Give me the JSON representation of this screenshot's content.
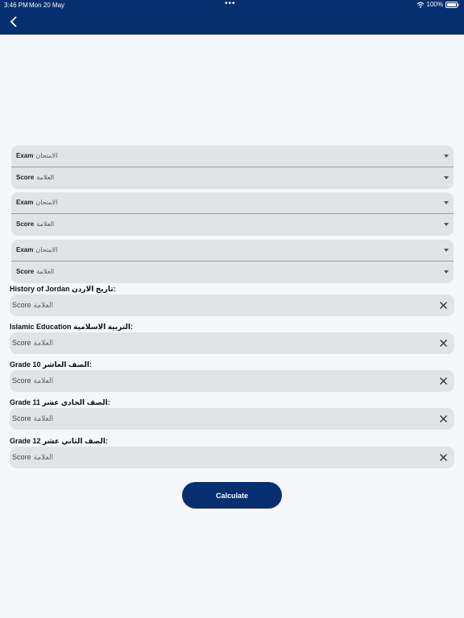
{
  "status_bar": {
    "time": "3:46 PM",
    "date": "Mon 20 May",
    "battery": "100%"
  },
  "exam_groups": [
    {
      "exam_en": "Exam",
      "exam_ar": "الامتحان",
      "score_en": "Score",
      "score_ar": "العلامة"
    },
    {
      "exam_en": "Exam",
      "exam_ar": "الامتحان",
      "score_en": "Score",
      "score_ar": "العلامة"
    },
    {
      "exam_en": "Exam",
      "exam_ar": "الامتحان",
      "score_en": "Score",
      "score_ar": "العلامة"
    }
  ],
  "fields": [
    {
      "label": "History of Jordan تاريخ الاردن:",
      "placeholder_en": "Score",
      "placeholder_ar": "العلامة"
    },
    {
      "label": "Islamic Education التربية الاسلامية:",
      "placeholder_en": "Score",
      "placeholder_ar": "العلامة"
    },
    {
      "label": "Grade 10 الصف العاشر:",
      "placeholder_en": "Score",
      "placeholder_ar": "العلامة"
    },
    {
      "label": "Grade 11 الصف الحادي عشر:",
      "placeholder_en": "Score",
      "placeholder_ar": "العلامة"
    },
    {
      "label": "Grade 12 الصف الثاني عشر:",
      "placeholder_en": "Score",
      "placeholder_ar": "العلامة"
    }
  ],
  "calculate_label": "Calculate",
  "colors": {
    "primary": "#052f6e",
    "field_bg": "#e2e3e6",
    "page_bg": "#f5f7fb"
  }
}
